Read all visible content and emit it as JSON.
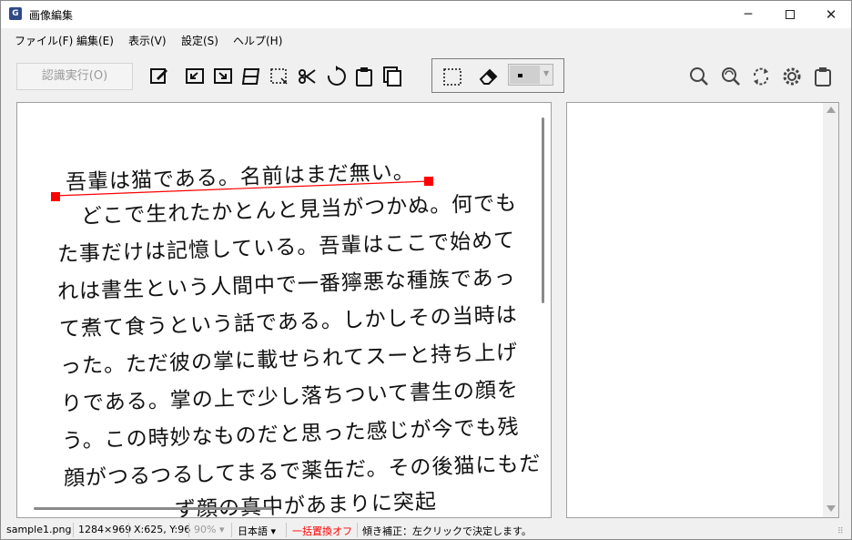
{
  "window": {
    "title": "画像編集",
    "icon": "app-icon-G",
    "controls": {
      "minimize": "─",
      "close": "✕"
    }
  },
  "menu": [
    "ファイル(F)",
    "編集(E)",
    "表示(V)",
    "設定(S)",
    "ヘルプ(H)"
  ],
  "toolbar": {
    "ocr_button": "認識実行(O)",
    "left_tools": [
      "edit-icon",
      "crop-left-icon",
      "crop-right-icon",
      "perspective-icon",
      "select-region-icon",
      "cut-icon",
      "rotate-icon",
      "paste-icon",
      "copy-icon"
    ],
    "group_tools": [
      "selection-rect-icon",
      "eraser-icon",
      "brush-size-select"
    ],
    "right_tools": [
      "zoom-icon",
      "zoom-reset-icon",
      "refresh-icon",
      "settings-icon",
      "clipboard-icon"
    ]
  },
  "document": {
    "lines": [
      "吾輩は猫である。名前はまだ無い。",
      "　どこで生れたかとんと見当がつかぬ。何でも",
      "た事だけは記憶している。吾輩はここで始めて",
      "れは書生という人間中で一番獰悪な種族であっ",
      "て煮て食うという話である。しかしその当時は",
      "った。ただ彼の掌に載せられてスーと持ち上げ",
      "りである。掌の上で少し落ちついて書生の顔を",
      "う。この時妙なものだと思った感じが今でも残",
      "顔がつるつるしてまるで薬缶だ。その後猫にもだ",
      "　　　　　ず顔の真中があまりに突起"
    ],
    "accent_color": "#ff0000"
  },
  "status": {
    "file": "sample1.png",
    "size": "1284×969",
    "coords": "X:625, Y:96",
    "zoom": "90%",
    "language": "日本語",
    "replace": "一括置換オフ",
    "replace_color": "#ff0000",
    "message": "傾き補正：左クリックで決定します。"
  }
}
